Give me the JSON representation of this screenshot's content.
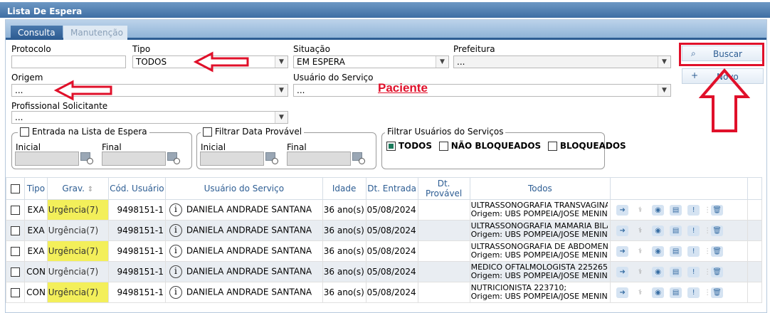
{
  "window": {
    "title": "Lista De Espera"
  },
  "tabs": [
    {
      "label": "Consulta",
      "active": true
    },
    {
      "label": "Manutenção",
      "active": false
    }
  ],
  "filters": {
    "protocolo": {
      "label": "Protocolo",
      "value": ""
    },
    "tipo": {
      "label": "Tipo",
      "value": "TODOS"
    },
    "situacao": {
      "label": "Situação",
      "value": "EM ESPERA"
    },
    "prefeitura": {
      "label": "Prefeitura",
      "value": "..."
    },
    "origem": {
      "label": "Origem",
      "value": "..."
    },
    "usuario_servico": {
      "label": "Usuário do Serviço",
      "value": "..."
    },
    "profissional": {
      "label": "Profissional Solicitante",
      "value": "..."
    },
    "entrada": {
      "legend": "Entrada na Lista de Espera",
      "inicial": "Inicial",
      "final": "Final"
    },
    "data_provavel": {
      "legend": "Filtrar Data Provável",
      "inicial": "Inicial",
      "final": "Final"
    },
    "filtrar_usuarios": {
      "legend": "Filtrar Usuários do Serviços",
      "opt_todos": "TODOS",
      "opt_nao_bloq": "NÃO BLOQUEADOS",
      "opt_bloq": "BLOQUEADOS"
    }
  },
  "buttons": {
    "buscar": "Buscar",
    "novo": "Novo"
  },
  "annotation": {
    "paciente": "Paciente"
  },
  "table": {
    "headers": {
      "tipo": "Tipo",
      "grav": "Grav.",
      "cod": "Cód. Usuário",
      "usuario": "Usuário do Serviço",
      "idade": "Idade",
      "dt_entrada": "Dt. Entrada",
      "dt_provavel": "Dt. Provável",
      "todos": "Todos"
    },
    "rows": [
      {
        "tipo": "EXA",
        "grav": "Urgência(7)",
        "cod": "9498151-1",
        "usuario": "DANIELA ANDRADE SANTANA",
        "idade": "36 ano(s)",
        "dt_entrada": "05/08/2024",
        "dt_provavel": "",
        "proc1": "ULTRASSONOGRAFIA TRANSVAGINAL",
        "proc2": "Origem: UBS POMPEIA/JOSE MENINO"
      },
      {
        "tipo": "EXA",
        "grav": "Urgência(7)",
        "cod": "9498151-1",
        "usuario": "DANIELA ANDRADE SANTANA",
        "idade": "36 ano(s)",
        "dt_entrada": "05/08/2024",
        "dt_provavel": "",
        "proc1": "ULTRASSONOGRAFIA MAMARIA BILATERAL",
        "proc2": "Origem: UBS POMPEIA/JOSE MENINO"
      },
      {
        "tipo": "EXA",
        "grav": "Urgência(7)",
        "cod": "9498151-1",
        "usuario": "DANIELA ANDRADE SANTANA",
        "idade": "36 ano(s)",
        "dt_entrada": "05/08/2024",
        "dt_provavel": "",
        "proc1": "ULTRASSONOGRAFIA DE ABDOMEN",
        "proc2": "Origem: UBS POMPEIA/JOSE MENINO"
      },
      {
        "tipo": "CON",
        "grav": "Urgência(7)",
        "cod": "9498151-1",
        "usuario": "DANIELA ANDRADE SANTANA",
        "idade": "36 ano(s)",
        "dt_entrada": "05/08/2024",
        "dt_provavel": "",
        "proc1": "MÉDICO OFTALMOLOGISTA 225265",
        "proc2": "Origem: UBS POMPEIA/JOSE MENINO"
      },
      {
        "tipo": "CON",
        "grav": "Urgência(7)",
        "cod": "9498151-1",
        "usuario": "DANIELA ANDRADE SANTANA",
        "idade": "36 ano(s)",
        "dt_entrada": "05/08/2024",
        "dt_provavel": "",
        "proc1": "NUTRICIONISTA 223710;",
        "proc2": "Origem: UBS POMPEIA/JOSE MENINO"
      }
    ]
  }
}
